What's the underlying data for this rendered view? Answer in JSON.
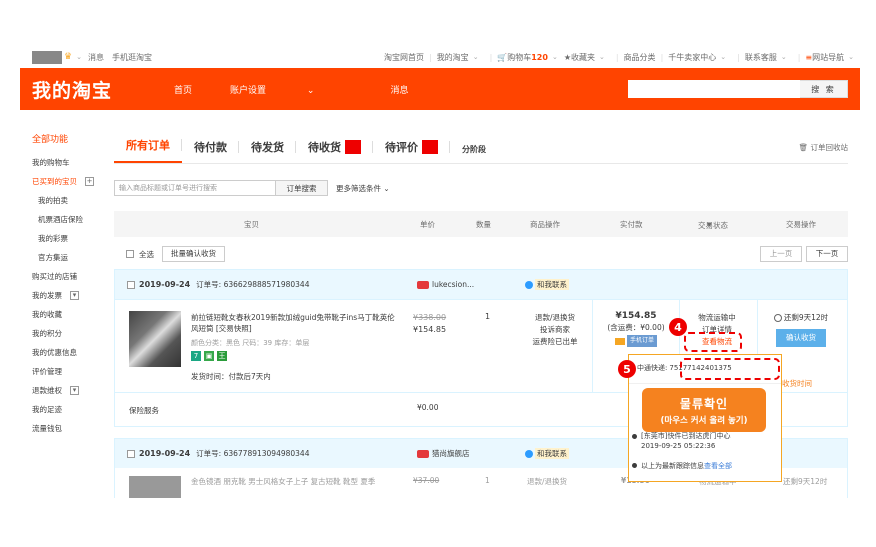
{
  "topbar": {
    "links_left": [
      "消息",
      "手机逛淘宝"
    ],
    "links_right": [
      "淘宝网首页",
      "我的淘宝",
      "购物车",
      "收藏夹",
      "商品分类",
      "千牛卖家中心",
      "联系客服",
      "网站导航"
    ],
    "cart_count": "120"
  },
  "header": {
    "logo": "我的淘宝",
    "nav": [
      "首页",
      "账户设置",
      "消息"
    ],
    "search_button": "搜 索",
    "search_placeholder": ""
  },
  "sidebar": {
    "head": "全部功能",
    "items": [
      {
        "label": "我的购物车",
        "sub": false,
        "active": false,
        "toggle": false
      },
      {
        "label": "已买到的宝贝",
        "sub": false,
        "active": true,
        "toggle": true
      },
      {
        "label": "我的拍卖",
        "sub": true,
        "active": false,
        "toggle": false
      },
      {
        "label": "机票酒店保险",
        "sub": true,
        "active": false,
        "toggle": false
      },
      {
        "label": "我的彩票",
        "sub": true,
        "active": false,
        "toggle": false
      },
      {
        "label": "官方集运",
        "sub": true,
        "active": false,
        "toggle": false
      },
      {
        "label": "购买过的店铺",
        "sub": false,
        "active": false,
        "toggle": false
      },
      {
        "label": "我的发票",
        "sub": false,
        "active": false,
        "toggle": true
      },
      {
        "label": "我的收藏",
        "sub": false,
        "active": false,
        "toggle": false
      },
      {
        "label": "我的积分",
        "sub": false,
        "active": false,
        "toggle": false
      },
      {
        "label": "我的优惠信息",
        "sub": false,
        "active": false,
        "toggle": false
      },
      {
        "label": "评价管理",
        "sub": false,
        "active": false,
        "toggle": false
      },
      {
        "label": "退款维权",
        "sub": false,
        "active": false,
        "toggle": true
      },
      {
        "label": "我的足迹",
        "sub": false,
        "active": false,
        "toggle": false
      },
      {
        "label": "流量钱包",
        "sub": false,
        "active": false,
        "toggle": false
      }
    ]
  },
  "tabs": {
    "all": "所有订单",
    "unpaid": "待付款",
    "unshipped": "待发货",
    "unreceived": "待收货",
    "unrated": "待评价",
    "installment": "分阶段",
    "recycle": "订单回收站"
  },
  "filter": {
    "placeholder": "输入商品标题或订单号进行搜索",
    "search_button": "订单搜索",
    "more": "更多筛选条件"
  },
  "table_header": {
    "item": "宝贝",
    "price": "单价",
    "qty": "数量",
    "ops": "商品操作",
    "paid": "实付款",
    "status": "交易状态",
    "action": "交易操作"
  },
  "batch": {
    "select_all": "全选",
    "confirm_batch": "批量确认收货",
    "prev": "上一页",
    "next": "下一页"
  },
  "order1": {
    "date": "2019-09-24",
    "order_id": "订单号: 636629888571980344",
    "shop": "lukecsion...",
    "contact": "和我联系",
    "title": "前拉链短靴女春秋2019新款加绒guid兔带靴子ins马丁靴英伦风短筒 [交易快照]",
    "attributes": "颜色分类：黑色  尺码：39  库存：单层",
    "ship_time": "发货时间：付款后7天内",
    "price_old": "¥338.00",
    "price": "¥154.85",
    "qty": "1",
    "ops": [
      "退款/退换货",
      "投诉商家",
      "运费险已出单"
    ],
    "paid_amount": "¥154.85",
    "shipping_note": "(含运费：¥0.00)",
    "mobile_badge": "手机订单",
    "status": "物流运输中",
    "details": "订单详情",
    "view_logistics": "查看物流",
    "remaining": "还剩9天12时",
    "confirm": "确认收货",
    "insurance": "保险服务",
    "insurance_amount": "¥0.00",
    "extend": "延长收货时间"
  },
  "order2": {
    "date": "2019-09-24",
    "order_id": "订单号: 636778913094980344",
    "shop": "猎尚旗舰店",
    "contact": "和我联系",
    "title_preview": "金色镜酒 朋克靴 男士风格女子上子 复古短靴 靴型 夏季",
    "price_old": "¥37.00",
    "qty": "1",
    "op": "退款/退换货",
    "paid": "¥18.50",
    "status": "物流运输中",
    "remaining": "还剩9天12时"
  },
  "tooltip": {
    "carrier_label": "中通快递:",
    "tracking_no": "75177142401375",
    "event_text": "[东莞市]快件已到达虎门中心",
    "event_time": "2019-09-25 05:22:36",
    "more_prefix": "以上为最新跟踪信息",
    "more_link": "查看全部"
  },
  "annotations": {
    "marker4": "4",
    "marker5": "5",
    "callout_line1": "물류확인",
    "callout_line2": "(마우스 커서 올려 놓기)"
  },
  "colors": {
    "brand_orange": "#ff4400",
    "annotation_red": "#e00000",
    "callout_orange": "#f5821f"
  }
}
